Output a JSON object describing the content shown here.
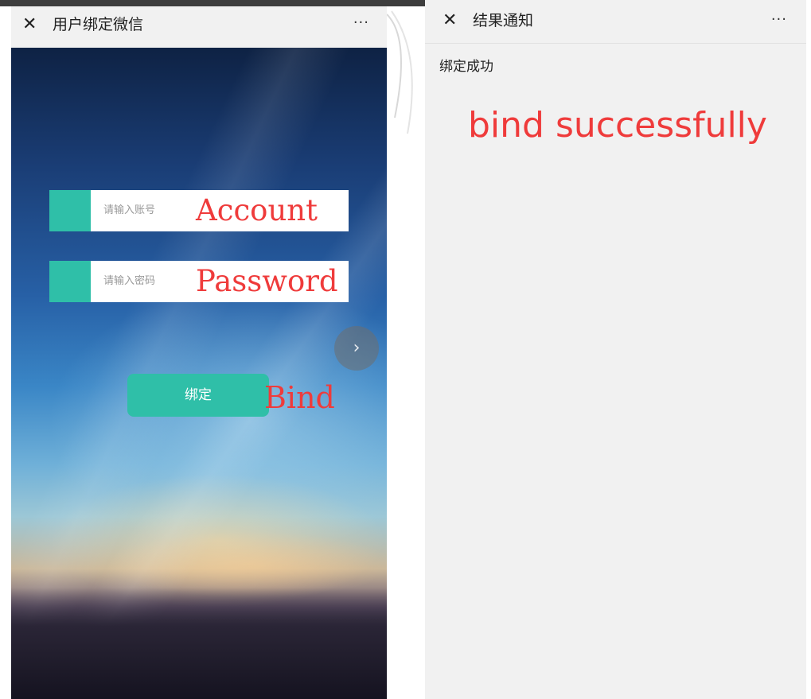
{
  "left_screen": {
    "title": "用户绑定微信",
    "close_icon": "close-icon",
    "more_label": "···",
    "account": {
      "placeholder": "请输入账号",
      "annotation": "Account"
    },
    "password": {
      "placeholder": "请输入密码",
      "annotation": "Password"
    },
    "bind_button": {
      "label": "绑定",
      "annotation": "Bind"
    },
    "scroll_glyph": "›"
  },
  "right_screen": {
    "title": "结果通知",
    "close_icon": "close-icon",
    "more_label": "···",
    "result_text": "绑定成功",
    "annotation": "bind successfully"
  },
  "colors": {
    "accent": "#2fbfa8",
    "annotation": "#ef3b3b",
    "nav_background": "#f1f1f1"
  }
}
